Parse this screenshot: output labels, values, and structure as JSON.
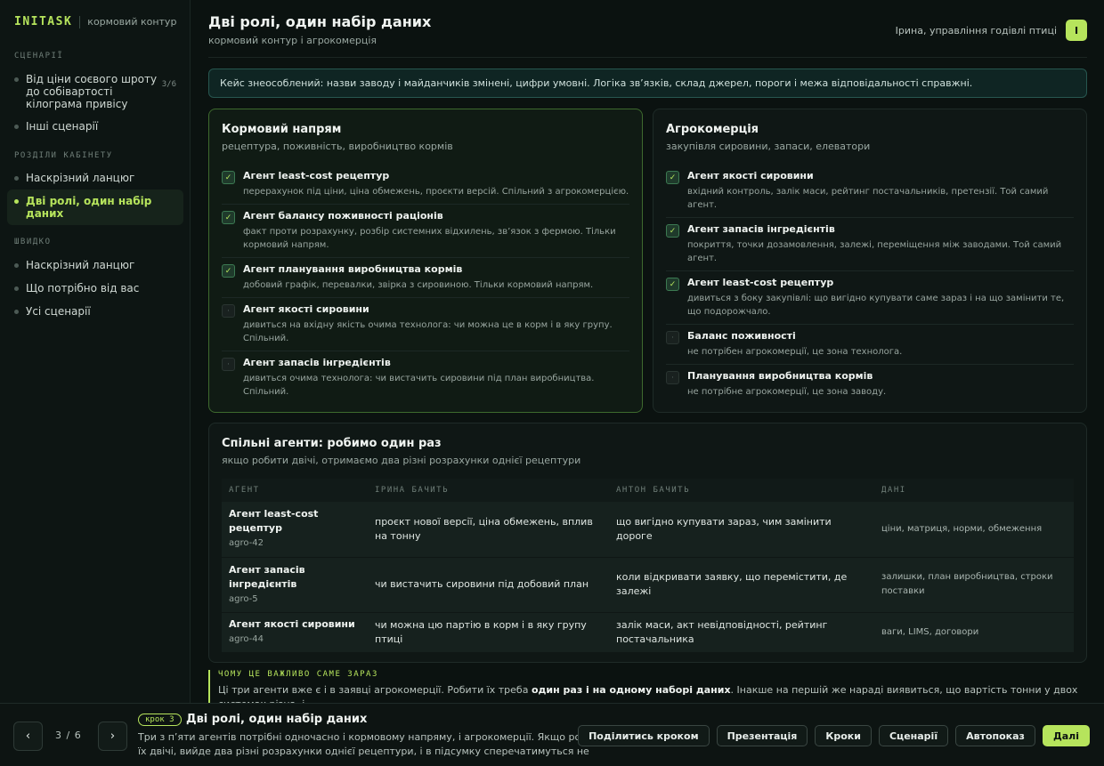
{
  "brand": {
    "logo": "INITASK",
    "subtitle": "кормовий контур"
  },
  "sidebar": {
    "sections": [
      {
        "title": "СЦЕНАРІЇ"
      },
      {
        "title": "РОЗДІЛИ КАБІНЕТУ"
      },
      {
        "title": "ШВИДКО"
      }
    ],
    "scenarios": [
      {
        "label": "Від ціни соєвого шроту до собівартості кілограма привісу",
        "count": "3/6"
      },
      {
        "label": "Інші сценарії"
      }
    ],
    "cabinet": [
      {
        "label": "Наскрізний ланцюг"
      },
      {
        "label": "Дві ролі, один набір даних"
      }
    ],
    "quick": [
      {
        "label": "Наскрізний ланцюг"
      },
      {
        "label": "Що потрібно від вас"
      },
      {
        "label": "Усі сценарії"
      }
    ]
  },
  "header": {
    "title": "Дві ролі, один набір даних",
    "subtitle": "кормовий контур і агрокомерція",
    "user": "Ірина, управління годівлі птиці",
    "avatar": "І"
  },
  "notice": "Кейс знеособлений: назви заводу і майданчиків змінені, цифри умовні. Логіка зв’язків, склад джерел, пороги і межа відповідальності справжні.",
  "feed_panel": {
    "title": "Кормовий напрям",
    "subtitle": "рецептура, поживність, виробництво кормів",
    "agents": [
      {
        "name": "Агент least-cost рецептур",
        "desc": "перерахунок під ціни, ціна обмежень, проєкти версій. Спільний з агрокомерцією.",
        "mark": "✓"
      },
      {
        "name": "Агент балансу поживності раціонів",
        "desc": "факт проти розрахунку, розбір системних відхилень, зв’язок з фермою. Тільки кормовий напрям.",
        "mark": "✓"
      },
      {
        "name": "Агент планування виробництва кормів",
        "desc": "добовий графік, перевалки, звірка з сировиною. Тільки кормовий напрям.",
        "mark": "✓"
      },
      {
        "name": "Агент якості сировини",
        "desc": "дивиться на вхідну якість очима технолога: чи можна це в корм і в яку групу. Спільний.",
        "mark": "·"
      },
      {
        "name": "Агент запасів інгредієнтів",
        "desc": "дивиться очима технолога: чи вистачить сировини під план виробництва. Спільний.",
        "mark": "·"
      }
    ]
  },
  "agro_panel": {
    "title": "Агрокомерція",
    "subtitle": "закупівля сировини, запаси, елеватори",
    "agents": [
      {
        "name": "Агент якості сировини",
        "desc": "вхідний контроль, залік маси, рейтинг постачальників, претензії. Той самий агент.",
        "mark": "✓"
      },
      {
        "name": "Агент запасів інгредієнтів",
        "desc": "покриття, точки дозамовлення, залежі, переміщення між заводами. Той самий агент.",
        "mark": "✓"
      },
      {
        "name": "Агент least-cost рецептур",
        "desc": "дивиться з боку закупівлі: що вигідно купувати саме зараз і на що замінити те, що подорожчало.",
        "mark": "✓"
      },
      {
        "name": "Баланс поживності",
        "desc": "не потрібен агрокомерції, це зона технолога.",
        "mark": "·"
      },
      {
        "name": "Планування виробництва кормів",
        "desc": "не потрібне агрокомерції, це зона заводу.",
        "mark": "·"
      }
    ]
  },
  "shared": {
    "title": "Спільні агенти: робимо один раз",
    "subtitle": "якщо робити двічі, отримаємо два різні розрахунки однієї рецептури",
    "columns": [
      "АГЕНТ",
      "ІРИНА БАЧИТЬ",
      "АНТОН БАЧИТЬ",
      "ДАНІ"
    ],
    "rows": [
      {
        "agent": "Агент least-cost рецептур",
        "code": "agro-42",
        "irina": "проєкт нової версії, ціна обмежень, вплив на тонну",
        "anton": "що вигідно купувати зараз, чим замінити дороге",
        "data": "ціни, матриця, норми, обмеження"
      },
      {
        "agent": "Агент запасів інгредієнтів",
        "code": "agro-5",
        "irina": "чи вистачить сировини під добовий план",
        "anton": "коли відкривати заявку, що перемістити, де залежі",
        "data": "залишки, план виробництва, строки поставки"
      },
      {
        "agent": "Агент якості сировини",
        "code": "agro-44",
        "irina": "чи можна цю партію в корм і в яку групу птиці",
        "anton": "залік маси, акт невідповідності, рейтинг постачальника",
        "data": "ваги, LIMS, договори"
      }
    ]
  },
  "why": {
    "title": "ЧОМУ ЦЕ ВАЖЛИВО САМЕ ЗАРАЗ",
    "text_before": "Ці три агенти вже є і в заявці агрокомерції. Робити їх треба ",
    "text_bold": "один раз і на одному наборі даних",
    "text_after": ". Інакше на першій же нараді виявиться, що вартість тонни у двох системах різна, і"
  },
  "bottom": {
    "prev": "‹",
    "next": "›",
    "pager": "3 / 6",
    "step_badge": "крок 3",
    "step_title": "Дві ролі, один набір даних",
    "step_desc": "Три з п’яти агентів потрібні одночасно і кормовому напряму, і агрокомерції. Якщо робити їх двічі, вийде два різні розрахунки однієї рецептури, і в підсумку сперечатимуться не пр...",
    "actions": [
      "Поділитись кроком",
      "Презентація",
      "Кроки",
      "Сценарії",
      "Автопоказ",
      "Далі"
    ]
  },
  "colors": {
    "accent": "#b6e45c",
    "background": "#0b1210",
    "panel": "#0f1715"
  }
}
